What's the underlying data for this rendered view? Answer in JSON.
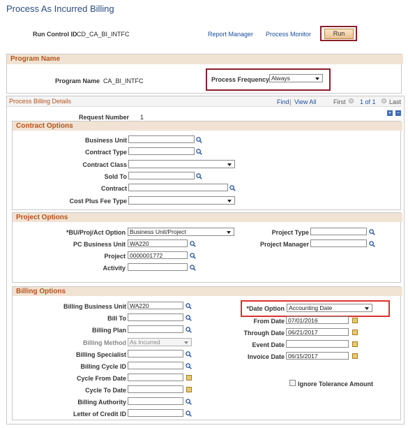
{
  "page": {
    "title": "Process As Incurred Billing"
  },
  "header": {
    "run_control_label": "Run Control ID",
    "run_control_value": "CD_CA_BI_INTFC",
    "report_manager": "Report Manager",
    "process_monitor": "Process Monitor",
    "run_button": "Run"
  },
  "program": {
    "section_title": "Program Name",
    "program_name_label": "Program Name",
    "program_name_value": "CA_BI_INTFC",
    "frequency_label": "Process Frequency",
    "frequency_value": "Always"
  },
  "details": {
    "section_title": "Process Billing Details",
    "find": "Find",
    "view_all": "View All",
    "first": "First",
    "pager": "1 of 1",
    "last": "Last",
    "request_label": "Request Number",
    "request_value": "1",
    "plus": "+",
    "minus": "−"
  },
  "contract": {
    "title": "Contract Options",
    "business_unit": "Business Unit",
    "contract_type": "Contract Type",
    "contract_class": "Contract Class",
    "sold_to": "Sold To",
    "contract": "Contract",
    "cost_plus_fee": "Cost Plus Fee Type"
  },
  "project": {
    "title": "Project Options",
    "bu_proj_act_label": "*BU/Proj/Act Option",
    "bu_proj_act_value": "Business Unit/Project",
    "pc_bu_label": "PC Business Unit",
    "pc_bu_value": "WA220",
    "project_label": "Project",
    "project_value": "0000001772",
    "activity_label": "Activity",
    "project_type_label": "Project Type",
    "project_manager_label": "Project Manager"
  },
  "billing": {
    "title": "Billing Options",
    "billing_bu_label": "Billing Business Unit",
    "billing_bu_value": "WA220",
    "bill_to": "Bill To",
    "billing_plan": "Billing Plan",
    "billing_method_label": "Billing Method",
    "billing_method_value": "As Incurred",
    "billing_specialist": "Billing Specialist",
    "billing_cycle_id": "Billing Cycle ID",
    "cycle_from_date": "Cycle From Date",
    "cycle_to_date": "Cycle To Date",
    "billing_authority": "Billing Authority",
    "letter_of_credit": "Letter of Credit ID",
    "date_option_label": "*Date Option",
    "date_option_value": "Accounting Date",
    "from_date_label": "From Date",
    "from_date_value": "07/01/2016",
    "through_date_label": "Through Date",
    "through_date_value": "06/21/2017",
    "event_date_label": "Event Date",
    "invoice_date_label": "Invoice Date",
    "invoice_date_value": "06/15/2017",
    "ignore_tolerance": "Ignore Tolerance Amount"
  }
}
